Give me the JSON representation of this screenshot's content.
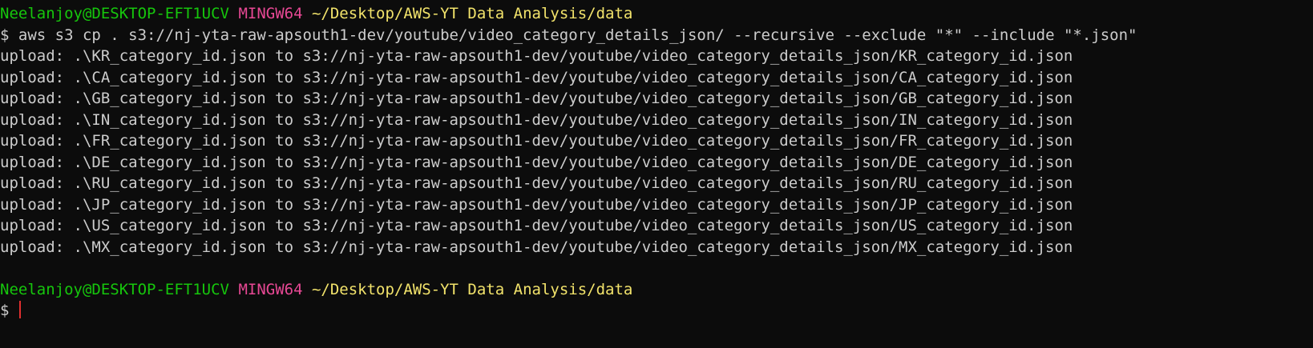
{
  "colors": {
    "background": "#0c0c0c",
    "text": "#cccccc",
    "user_host": "#16c60c",
    "system": "#e74894",
    "path": "#f2e36b",
    "cursor": "#e02f2f"
  },
  "prompt1": {
    "user_host": "Neelanjoy@DESKTOP-EFT1UCV",
    "system": "MINGW64",
    "path": "~/Desktop/AWS-YT Data Analysis/data"
  },
  "command": {
    "symbol": "$",
    "text": "aws s3 cp . s3://nj-yta-raw-apsouth1-dev/youtube/video_category_details_json/ --recursive --exclude \"*\" --include \"*.json\""
  },
  "output_lines": [
    "upload: .\\KR_category_id.json to s3://nj-yta-raw-apsouth1-dev/youtube/video_category_details_json/KR_category_id.json",
    "upload: .\\CA_category_id.json to s3://nj-yta-raw-apsouth1-dev/youtube/video_category_details_json/CA_category_id.json",
    "upload: .\\GB_category_id.json to s3://nj-yta-raw-apsouth1-dev/youtube/video_category_details_json/GB_category_id.json",
    "upload: .\\IN_category_id.json to s3://nj-yta-raw-apsouth1-dev/youtube/video_category_details_json/IN_category_id.json",
    "upload: .\\FR_category_id.json to s3://nj-yta-raw-apsouth1-dev/youtube/video_category_details_json/FR_category_id.json",
    "upload: .\\DE_category_id.json to s3://nj-yta-raw-apsouth1-dev/youtube/video_category_details_json/DE_category_id.json",
    "upload: .\\RU_category_id.json to s3://nj-yta-raw-apsouth1-dev/youtube/video_category_details_json/RU_category_id.json",
    "upload: .\\JP_category_id.json to s3://nj-yta-raw-apsouth1-dev/youtube/video_category_details_json/JP_category_id.json",
    "upload: .\\US_category_id.json to s3://nj-yta-raw-apsouth1-dev/youtube/video_category_details_json/US_category_id.json",
    "upload: .\\MX_category_id.json to s3://nj-yta-raw-apsouth1-dev/youtube/video_category_details_json/MX_category_id.json"
  ],
  "prompt2": {
    "user_host": "Neelanjoy@DESKTOP-EFT1UCV",
    "system": "MINGW64",
    "path": "~/Desktop/AWS-YT Data Analysis/data"
  },
  "final_prompt": {
    "symbol": "$"
  }
}
